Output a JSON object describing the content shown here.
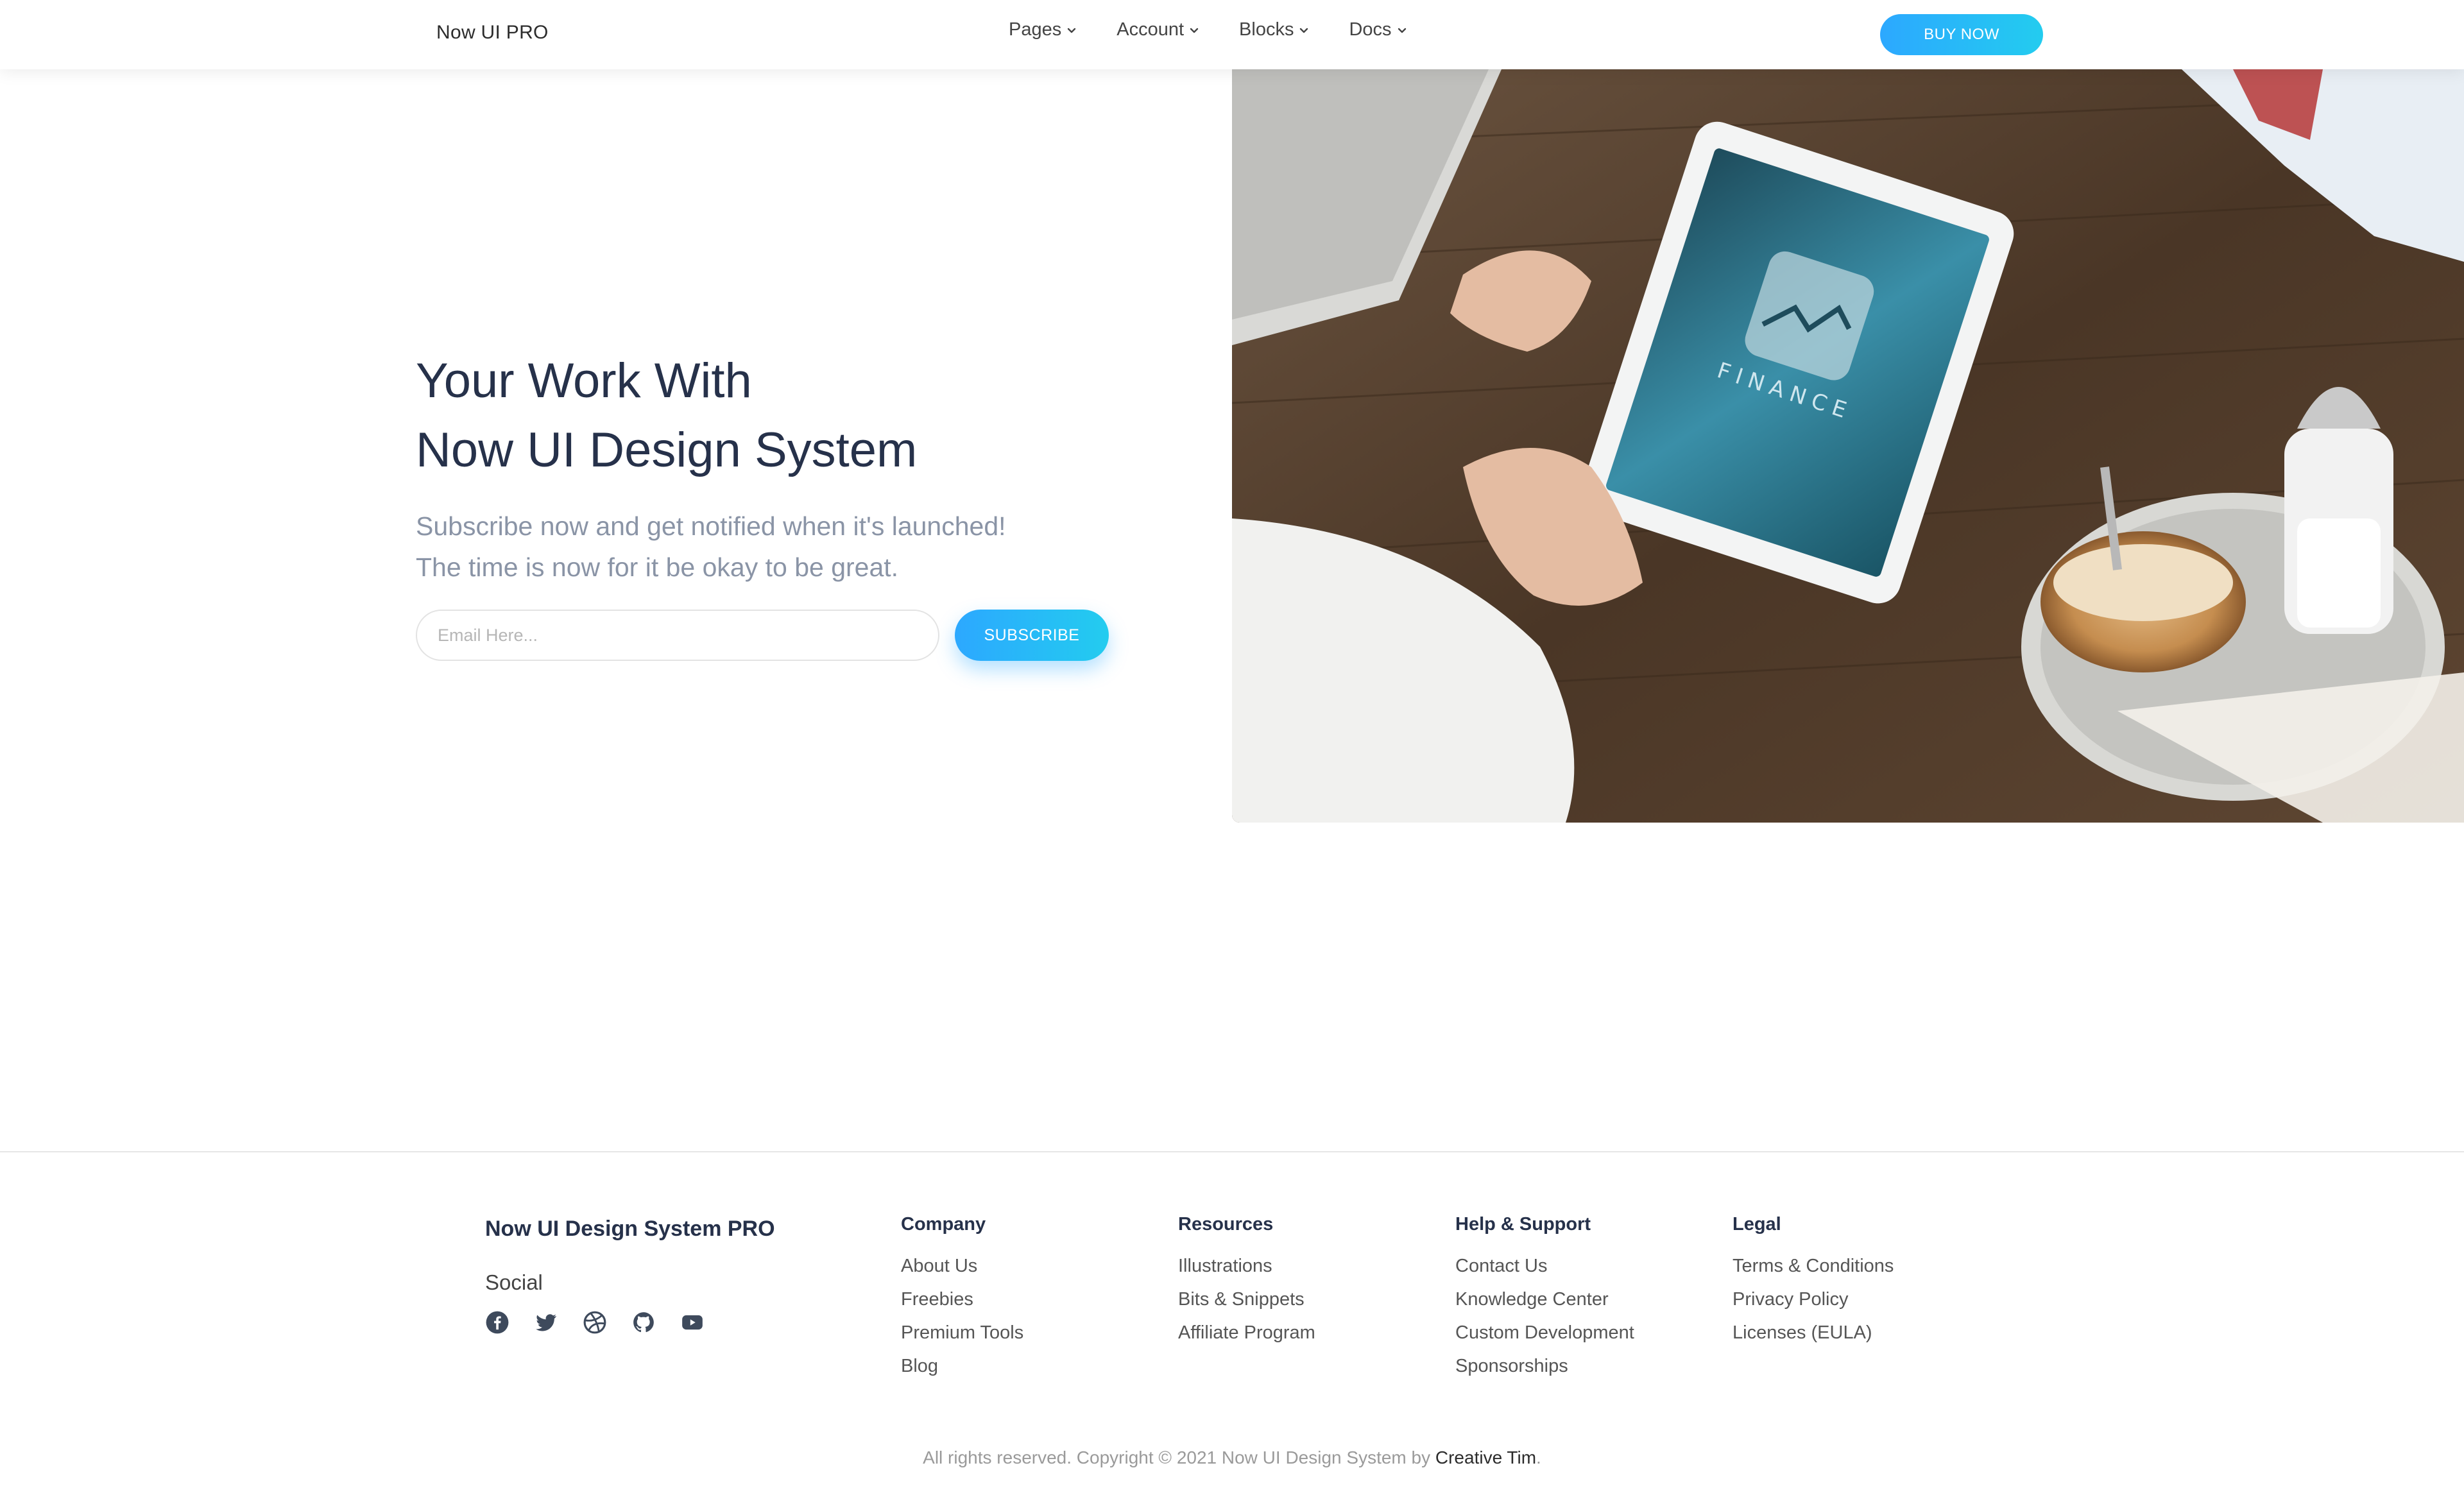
{
  "navbar": {
    "brand": "Now UI PRO",
    "links": [
      {
        "label": "Pages"
      },
      {
        "label": "Account"
      },
      {
        "label": "Blocks"
      },
      {
        "label": "Docs"
      }
    ],
    "cta": "BUY NOW"
  },
  "hero": {
    "title_line1": "Your Work With",
    "title_line2": "Now UI Design System",
    "subtitle_line1": "Subscribe now and get notified when it's launched!",
    "subtitle_line2": "The time is now for it be okay to be great.",
    "email_placeholder": "Email Here...",
    "email_value": "",
    "subscribe_label": "SUBSCRIBE",
    "image_text": "FINANCE"
  },
  "footer": {
    "brand": "Now UI Design System PRO",
    "social_label": "Social",
    "social_icons": [
      "facebook-icon",
      "twitter-icon",
      "dribbble-icon",
      "github-icon",
      "youtube-icon"
    ],
    "columns": [
      {
        "title": "Company",
        "items": [
          "About Us",
          "Freebies",
          "Premium Tools",
          "Blog"
        ]
      },
      {
        "title": "Resources",
        "items": [
          "Illustrations",
          "Bits & Snippets",
          "Affiliate Program"
        ]
      },
      {
        "title": "Help & Support",
        "items": [
          "Contact Us",
          "Knowledge Center",
          "Custom Development",
          "Sponsorships"
        ]
      },
      {
        "title": "Legal",
        "items": [
          "Terms & Conditions",
          "Privacy Policy",
          "Licenses (EULA)"
        ]
      }
    ],
    "copyright_prefix": "All rights reserved. Copyright © 2021 Now UI Design System by ",
    "copyright_link": "Creative Tim",
    "copyright_suffix": "."
  },
  "colors": {
    "accent_start": "#2ca8ff",
    "accent_end": "#23ccef",
    "heading": "#26314a",
    "muted": "#8a94a6"
  }
}
